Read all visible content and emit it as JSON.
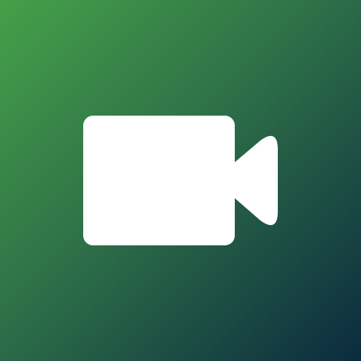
{
  "icon": {
    "name": "video-camera-icon",
    "glyph_color": "#ffffff"
  },
  "background": {
    "gradient_start": "#45a049",
    "gradient_mid": "#2e7048",
    "gradient_end": "#0b2b3f"
  }
}
